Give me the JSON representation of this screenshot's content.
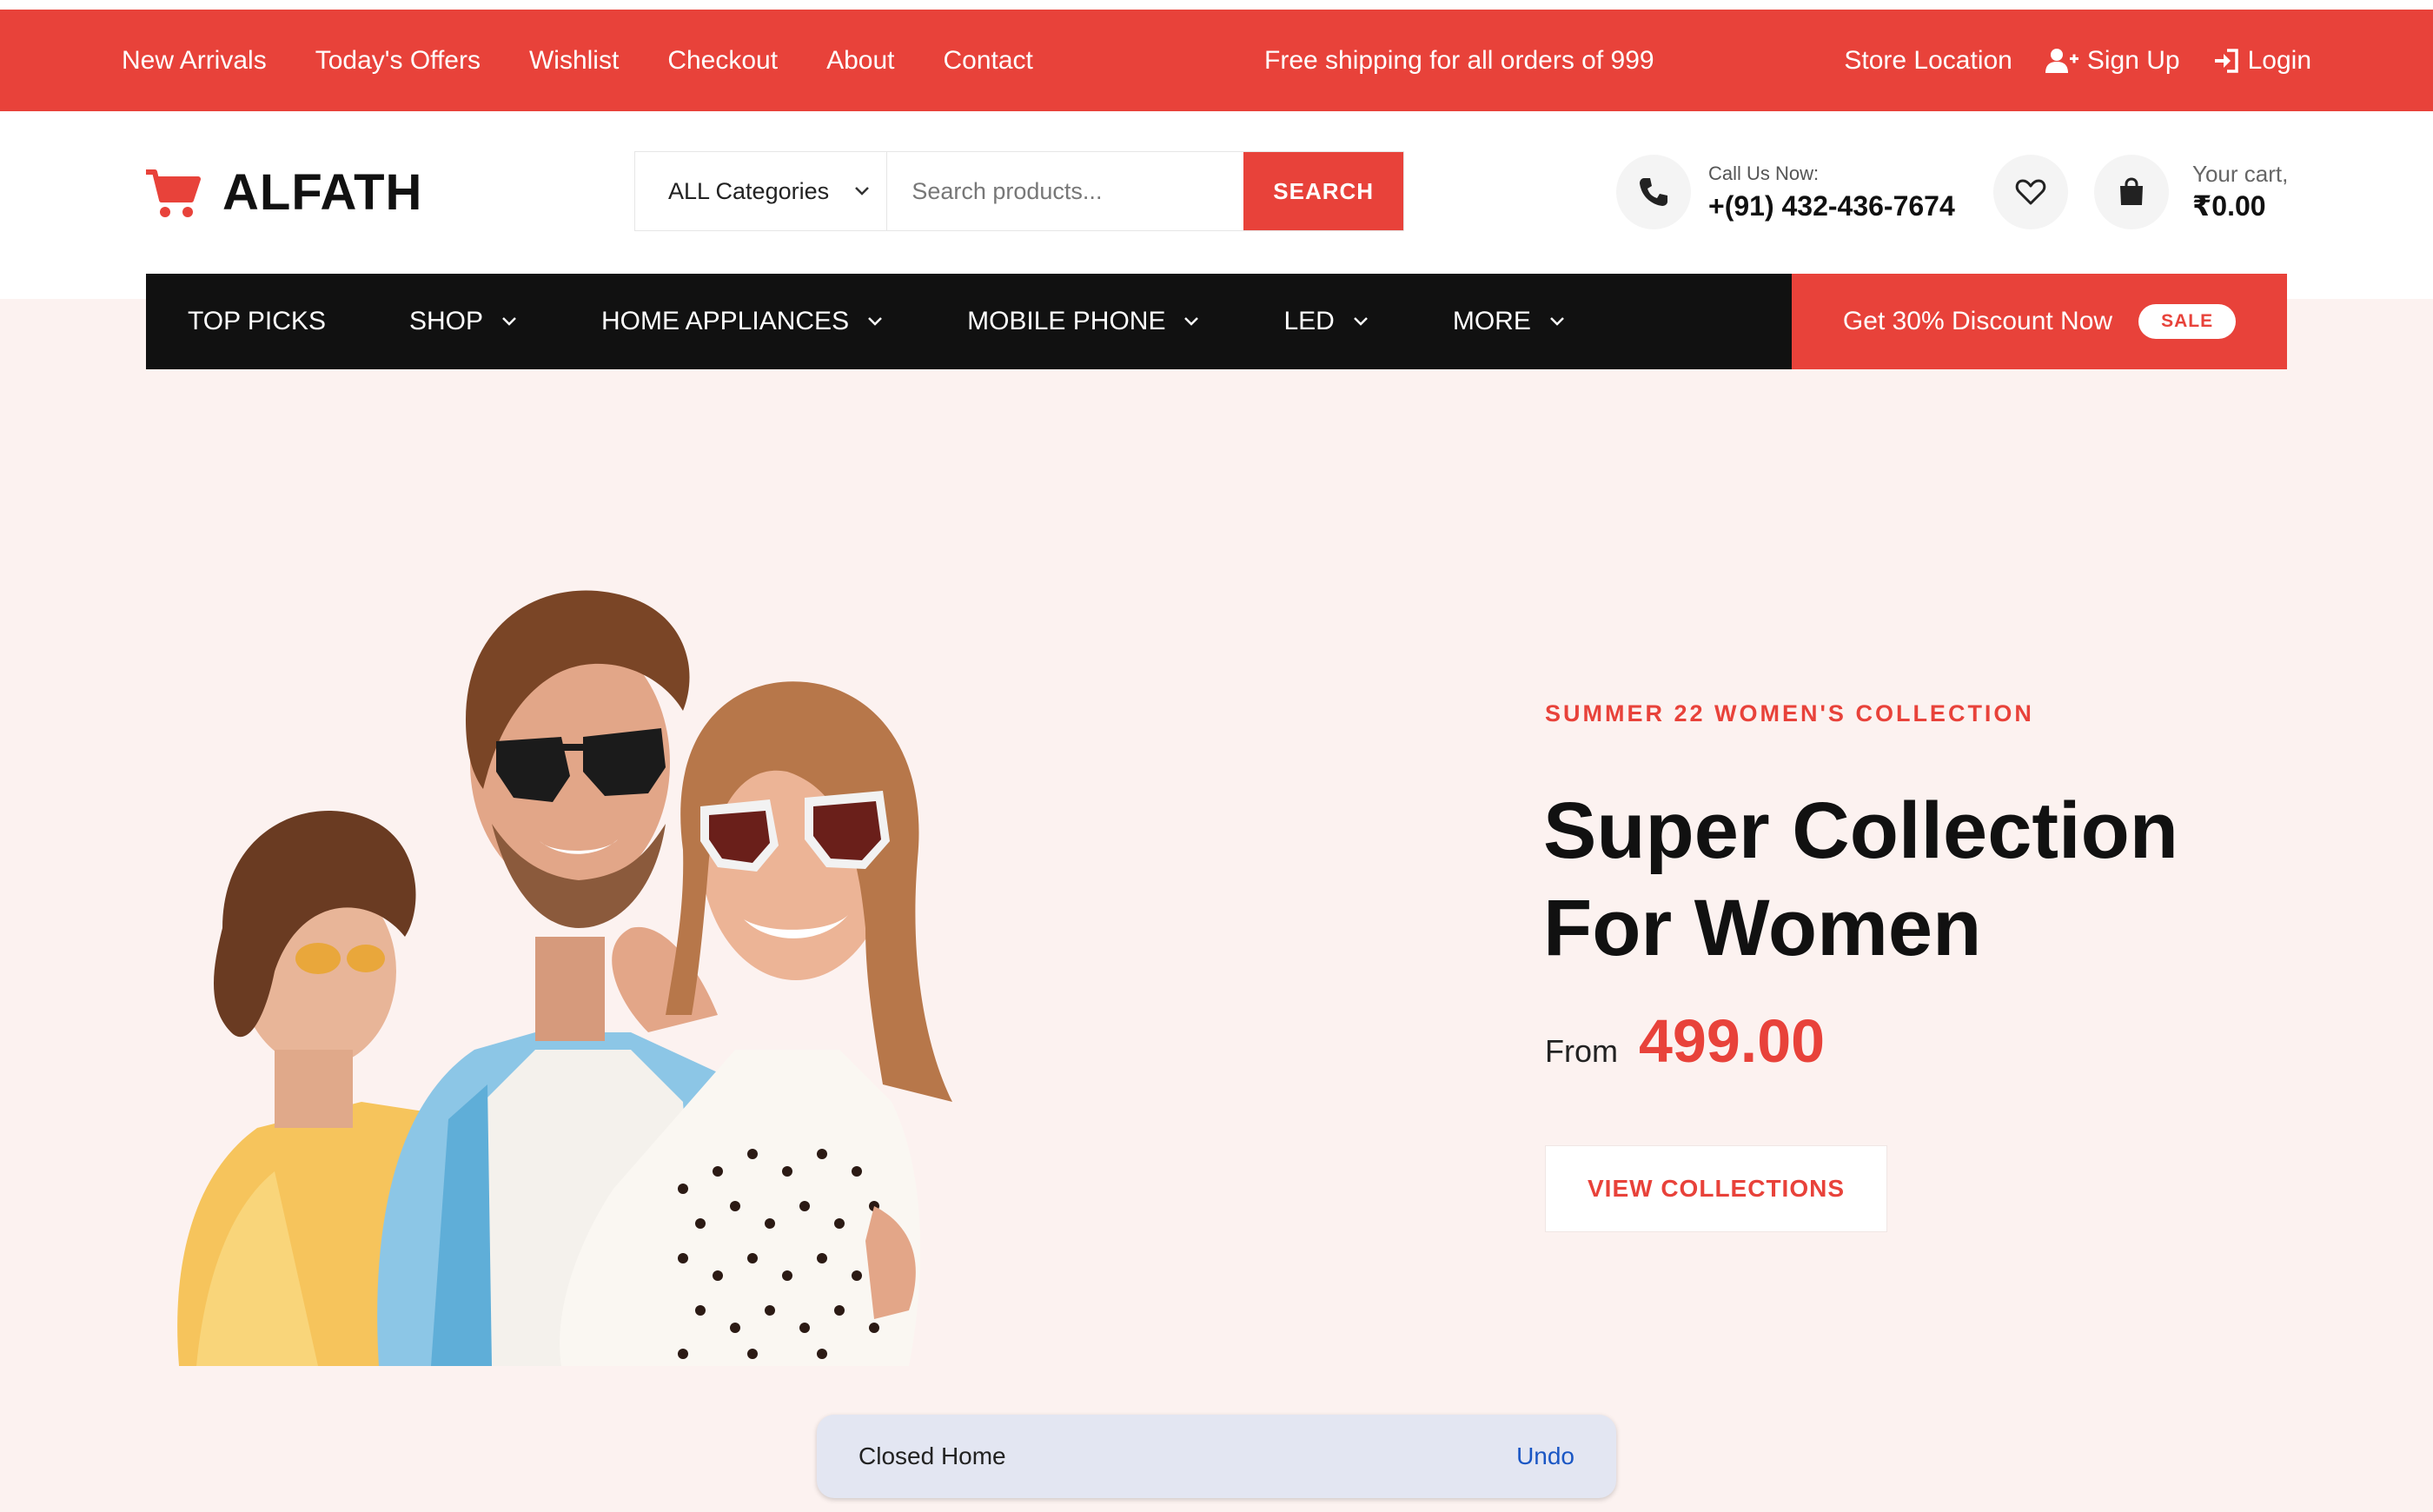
{
  "topbar": {
    "nav": [
      "New Arrivals",
      "Today's Offers",
      "Wishlist",
      "Checkout",
      "About",
      "Contact"
    ],
    "promo": "Free shipping for all orders of 999",
    "store_location": "Store Location",
    "sign_up": "Sign Up",
    "login": "Login"
  },
  "header": {
    "logo_text": "ALFATH",
    "category_select": "ALL Categories",
    "search_placeholder": "Search products...",
    "search_button": "SEARCH",
    "call_label": "Call Us Now:",
    "phone": "+(91) 432-436-7674",
    "cart_label": "Your cart,",
    "cart_total": "₹0.00"
  },
  "mainnav": {
    "items": [
      {
        "label": "TOP PICKS",
        "dropdown": false
      },
      {
        "label": "SHOP",
        "dropdown": true
      },
      {
        "label": "HOME APPLIANCES",
        "dropdown": true
      },
      {
        "label": "MOBILE PHONE",
        "dropdown": true
      },
      {
        "label": "LED",
        "dropdown": true
      },
      {
        "label": "MORE",
        "dropdown": true
      }
    ],
    "discount_text": "Get 30% Discount Now",
    "sale_badge": "SALE"
  },
  "hero": {
    "eyebrow": "SUMMER 22 WOMEN'S COLLECTION",
    "title_line1": "Super Collection",
    "title_line2": "For Women",
    "from_label": "From",
    "price": "499.00",
    "cta": "VIEW COLLECTIONS"
  },
  "snackbar": {
    "message": "Closed Home",
    "action": "Undo"
  },
  "colors": {
    "accent": "#e8423a",
    "nav_bg": "#111111",
    "page_bg": "#fcf2f0",
    "snackbar_bg": "#e3e6f2",
    "link_blue": "#1a56c4"
  }
}
